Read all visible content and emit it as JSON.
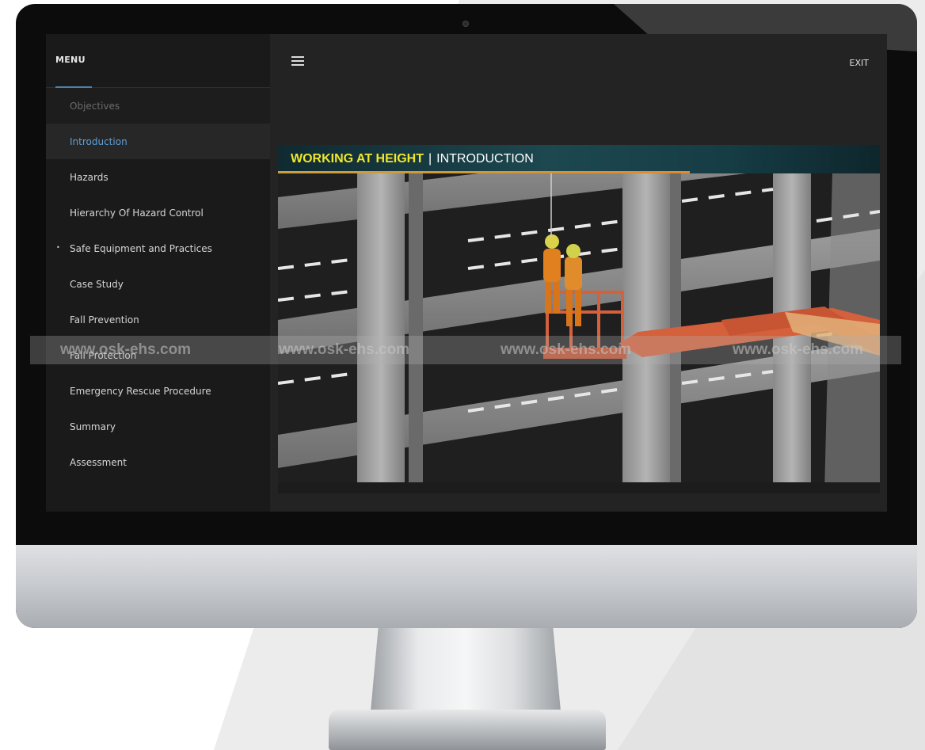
{
  "menu": {
    "title": "MENU",
    "items": [
      {
        "label": "Objectives",
        "state": "visited"
      },
      {
        "label": "Introduction",
        "state": "active"
      },
      {
        "label": "Hazards",
        "state": "default"
      },
      {
        "label": "Hierarchy Of Hazard Control",
        "state": "default"
      },
      {
        "label": "Safe Equipment and Practices",
        "state": "default",
        "has_submenu": true
      },
      {
        "label": "Case Study",
        "state": "default"
      },
      {
        "label": "Fall Prevention",
        "state": "default"
      },
      {
        "label": "Fall Protection",
        "state": "default"
      },
      {
        "label": "Emergency Rescue Procedure",
        "state": "default"
      },
      {
        "label": "Summary",
        "state": "default"
      },
      {
        "label": "Assessment",
        "state": "default"
      }
    ],
    "bullet_glyph": "•"
  },
  "toolbar": {
    "menu_icon": "hamburger-icon",
    "exit_label": "EXIT"
  },
  "slide": {
    "title_main": "WORKING AT HEIGHT",
    "title_separator": "|",
    "title_sub": "INTRODUCTION"
  },
  "watermark": {
    "texts": [
      "www.osk-ehs.com",
      "www.osk-ehs.com",
      "www.osk-ehs.com",
      "www.osk-ehs.com"
    ]
  },
  "colors": {
    "accent_blue": "#5f9ed6",
    "title_yellow": "#f1e629",
    "lift_orange": "#d4603c",
    "title_bar_teal": "#1d4850"
  }
}
